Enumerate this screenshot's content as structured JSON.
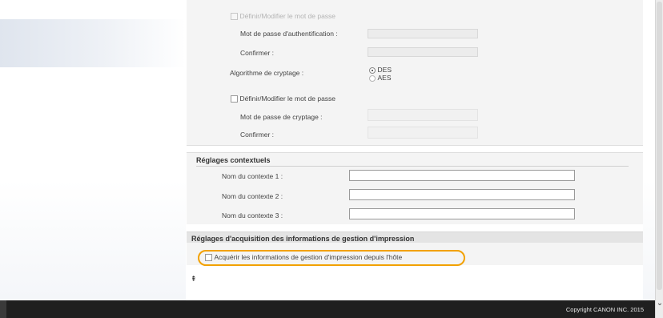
{
  "snmpv3": {
    "set_auth_password_label": "Définir/Modifier le mot de passe",
    "auth_password_label": "Mot de passe d'authentification :",
    "confirm_label_1": "Confirmer :",
    "encryption_algorithm_label": "Algorithme de cryptage :",
    "algorithm_options": [
      "DES",
      "AES"
    ],
    "selected_algorithm": "DES",
    "set_encryption_password_label": "Définir/Modifier le mot de passe",
    "encryption_password_label": "Mot de passe de cryptage :",
    "confirm_label_2": "Confirmer :"
  },
  "context": {
    "title": "Réglages contextuels",
    "fields": [
      {
        "label": "Nom du contexte 1 :",
        "value": ""
      },
      {
        "label": "Nom du contexte 2 :",
        "value": ""
      },
      {
        "label": "Nom du contexte 3 :",
        "value": ""
      }
    ]
  },
  "acquisition": {
    "title": "Réglages d'acquisition des informations de gestion d'impression",
    "checkbox_label": "Acquérir les informations de gestion d'impression depuis l'hôte",
    "checked": false,
    "highlight_color": "#f2a100"
  },
  "page_top_icon": "⇞",
  "footer": {
    "copyright": "Copyright CANON INC. 2015"
  },
  "scrollbar": {
    "down_arrow": "⌄"
  }
}
